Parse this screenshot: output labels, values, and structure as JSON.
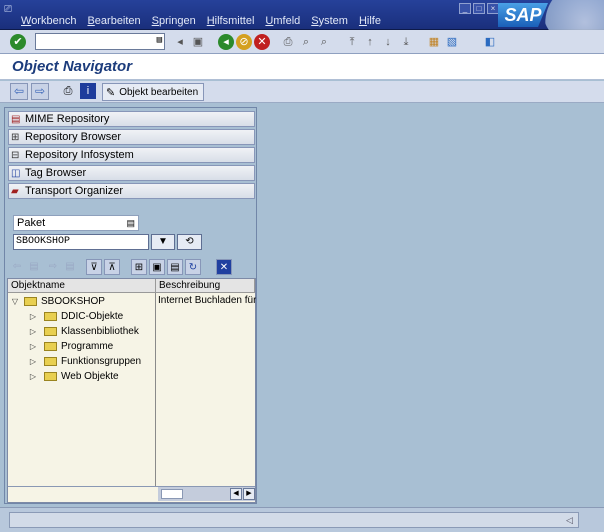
{
  "menubar": {
    "system_icon": "window-icon",
    "items": [
      "Workbench",
      "Bearbeiten",
      "Springen",
      "Hilfsmittel",
      "Umfeld",
      "System",
      "Hilfe"
    ],
    "logo": "SAP"
  },
  "toolbar": {
    "command_value": "",
    "ok_icon": "checkmark-icon"
  },
  "title": "Object Navigator",
  "app_toolbar": {
    "edit_object_label": "Objekt bearbeiten"
  },
  "repository_buttons": [
    {
      "label": "MIME Repository",
      "icon": "mime-icon"
    },
    {
      "label": "Repository Browser",
      "icon": "hierarchy-icon"
    },
    {
      "label": "Repository Infosystem",
      "icon": "infosystem-icon"
    },
    {
      "label": "Tag Browser",
      "icon": "tag-icon"
    },
    {
      "label": "Transport Organizer",
      "icon": "truck-icon"
    }
  ],
  "object_selector": {
    "type_value": "Paket",
    "name_value": "SBOOKSHOP"
  },
  "tree": {
    "columns": [
      "Objektname",
      "Beschreibung"
    ],
    "root": {
      "name": "SBOOKSHOP",
      "description": "Internet Buchladen für"
    },
    "children": [
      "DDIC-Objekte",
      "Klassenbibliothek",
      "Programme",
      "Funktionsgruppen",
      "Web Objekte"
    ]
  },
  "colors": {
    "accent": "#26419a",
    "background": "#a8bfd3",
    "tree_bg": "#f6f4e6"
  }
}
